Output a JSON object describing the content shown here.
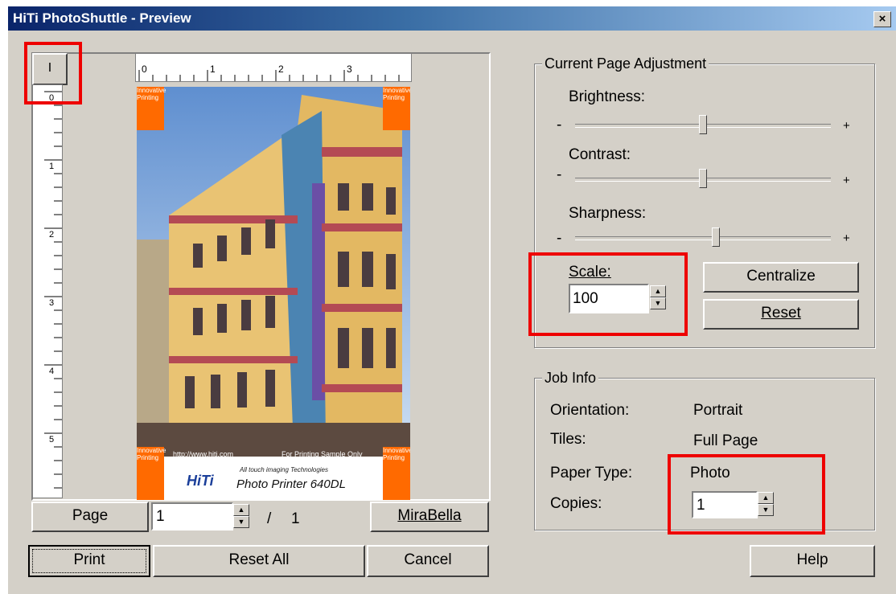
{
  "window": {
    "title": "HiTi PhotoShuttle - Preview",
    "close_label": "×"
  },
  "ruler": {
    "corner_label": "I",
    "h_ticks": [
      "0",
      "1",
      "2",
      "3"
    ],
    "v_ticks": [
      "0",
      "1",
      "2",
      "3",
      "4",
      "5"
    ]
  },
  "preview": {
    "url_text": "http://www.hiti.com",
    "sample_text": "For Printing Sample Only",
    "brand_tagline": "All touch imaging Technologies",
    "brand_logo": "HiTi",
    "printer_name": "Photo Printer 640DL",
    "tag_text": "Innovative Printing"
  },
  "page_nav": {
    "page_label": "Page",
    "page_value": "1",
    "separator": "/",
    "total": "1",
    "mirabella_label": "MiraBella"
  },
  "buttons": {
    "print": "Print",
    "reset_all": "Reset All",
    "cancel": "Cancel",
    "help": "Help",
    "centralize": "Centralize",
    "reset": "Reset"
  },
  "adjust": {
    "group_title": "Current Page Adjustment",
    "minus": "-",
    "plus": "+",
    "brightness_label": "Brightness:",
    "brightness_value": 0.5,
    "contrast_label": "Contrast:",
    "contrast_value": 0.5,
    "sharpness_label": "Sharpness:",
    "sharpness_value": 0.55,
    "scale_label": "Scale:",
    "scale_value": "100"
  },
  "job": {
    "group_title": "Job Info",
    "orientation_label": "Orientation:",
    "orientation_value": "Portrait",
    "tiles_label": "Tiles:",
    "tiles_value": "Full Page",
    "paper_label": "Paper Type:",
    "paper_value": "Photo",
    "copies_label": "Copies:",
    "copies_value": "1"
  },
  "colors": {
    "highlight": "#e00000",
    "title_start": "#0a246a",
    "tag": "#ff6a00"
  }
}
